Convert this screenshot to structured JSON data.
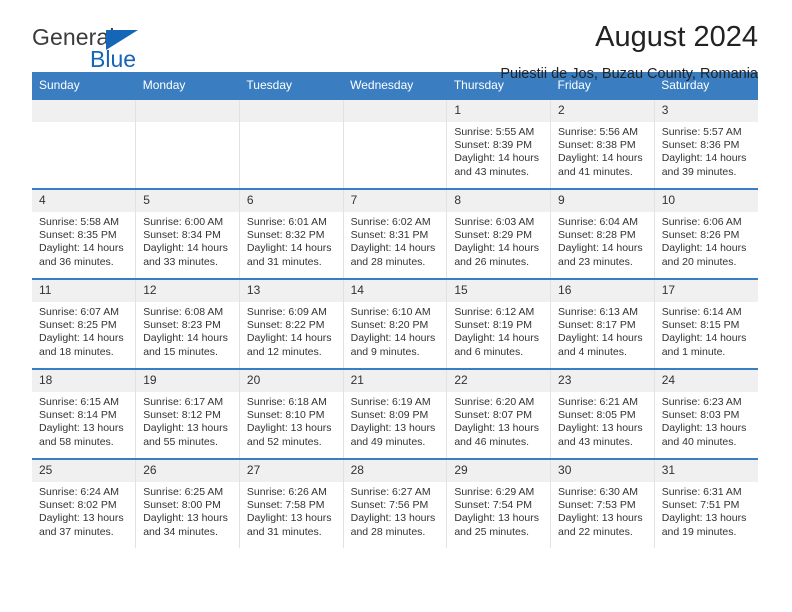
{
  "brand": {
    "name_top": "General",
    "name_bottom": "Blue",
    "accent_color": "#1565b8",
    "triangle_icon": "brand-triangle-icon"
  },
  "header": {
    "title": "August 2024",
    "subtitle": "Puiestii de Jos, Buzau County, Romania"
  },
  "theme": {
    "header_row_bg": "#3a7ec1",
    "day_band_bg": "#f0f0f0",
    "row_divider": "#3a7ec1",
    "text": "#333333"
  },
  "calendar": {
    "weekday_headers": [
      "Sunday",
      "Monday",
      "Tuesday",
      "Wednesday",
      "Thursday",
      "Friday",
      "Saturday"
    ],
    "weeks": [
      [
        {
          "day": "",
          "empty": true,
          "sunrise": "",
          "sunset": "",
          "daylight_line1": "",
          "daylight_line2": ""
        },
        {
          "day": "",
          "empty": true,
          "sunrise": "",
          "sunset": "",
          "daylight_line1": "",
          "daylight_line2": ""
        },
        {
          "day": "",
          "empty": true,
          "sunrise": "",
          "sunset": "",
          "daylight_line1": "",
          "daylight_line2": ""
        },
        {
          "day": "",
          "empty": true,
          "sunrise": "",
          "sunset": "",
          "daylight_line1": "",
          "daylight_line2": ""
        },
        {
          "day": "1",
          "sunrise": "Sunrise: 5:55 AM",
          "sunset": "Sunset: 8:39 PM",
          "daylight_line1": "Daylight: 14 hours",
          "daylight_line2": "and 43 minutes."
        },
        {
          "day": "2",
          "sunrise": "Sunrise: 5:56 AM",
          "sunset": "Sunset: 8:38 PM",
          "daylight_line1": "Daylight: 14 hours",
          "daylight_line2": "and 41 minutes."
        },
        {
          "day": "3",
          "sunrise": "Sunrise: 5:57 AM",
          "sunset": "Sunset: 8:36 PM",
          "daylight_line1": "Daylight: 14 hours",
          "daylight_line2": "and 39 minutes."
        }
      ],
      [
        {
          "day": "4",
          "sunrise": "Sunrise: 5:58 AM",
          "sunset": "Sunset: 8:35 PM",
          "daylight_line1": "Daylight: 14 hours",
          "daylight_line2": "and 36 minutes."
        },
        {
          "day": "5",
          "sunrise": "Sunrise: 6:00 AM",
          "sunset": "Sunset: 8:34 PM",
          "daylight_line1": "Daylight: 14 hours",
          "daylight_line2": "and 33 minutes."
        },
        {
          "day": "6",
          "sunrise": "Sunrise: 6:01 AM",
          "sunset": "Sunset: 8:32 PM",
          "daylight_line1": "Daylight: 14 hours",
          "daylight_line2": "and 31 minutes."
        },
        {
          "day": "7",
          "sunrise": "Sunrise: 6:02 AM",
          "sunset": "Sunset: 8:31 PM",
          "daylight_line1": "Daylight: 14 hours",
          "daylight_line2": "and 28 minutes."
        },
        {
          "day": "8",
          "sunrise": "Sunrise: 6:03 AM",
          "sunset": "Sunset: 8:29 PM",
          "daylight_line1": "Daylight: 14 hours",
          "daylight_line2": "and 26 minutes."
        },
        {
          "day": "9",
          "sunrise": "Sunrise: 6:04 AM",
          "sunset": "Sunset: 8:28 PM",
          "daylight_line1": "Daylight: 14 hours",
          "daylight_line2": "and 23 minutes."
        },
        {
          "day": "10",
          "sunrise": "Sunrise: 6:06 AM",
          "sunset": "Sunset: 8:26 PM",
          "daylight_line1": "Daylight: 14 hours",
          "daylight_line2": "and 20 minutes."
        }
      ],
      [
        {
          "day": "11",
          "sunrise": "Sunrise: 6:07 AM",
          "sunset": "Sunset: 8:25 PM",
          "daylight_line1": "Daylight: 14 hours",
          "daylight_line2": "and 18 minutes."
        },
        {
          "day": "12",
          "sunrise": "Sunrise: 6:08 AM",
          "sunset": "Sunset: 8:23 PM",
          "daylight_line1": "Daylight: 14 hours",
          "daylight_line2": "and 15 minutes."
        },
        {
          "day": "13",
          "sunrise": "Sunrise: 6:09 AM",
          "sunset": "Sunset: 8:22 PM",
          "daylight_line1": "Daylight: 14 hours",
          "daylight_line2": "and 12 minutes."
        },
        {
          "day": "14",
          "sunrise": "Sunrise: 6:10 AM",
          "sunset": "Sunset: 8:20 PM",
          "daylight_line1": "Daylight: 14 hours",
          "daylight_line2": "and 9 minutes."
        },
        {
          "day": "15",
          "sunrise": "Sunrise: 6:12 AM",
          "sunset": "Sunset: 8:19 PM",
          "daylight_line1": "Daylight: 14 hours",
          "daylight_line2": "and 6 minutes."
        },
        {
          "day": "16",
          "sunrise": "Sunrise: 6:13 AM",
          "sunset": "Sunset: 8:17 PM",
          "daylight_line1": "Daylight: 14 hours",
          "daylight_line2": "and 4 minutes."
        },
        {
          "day": "17",
          "sunrise": "Sunrise: 6:14 AM",
          "sunset": "Sunset: 8:15 PM",
          "daylight_line1": "Daylight: 14 hours",
          "daylight_line2": "and 1 minute."
        }
      ],
      [
        {
          "day": "18",
          "sunrise": "Sunrise: 6:15 AM",
          "sunset": "Sunset: 8:14 PM",
          "daylight_line1": "Daylight: 13 hours",
          "daylight_line2": "and 58 minutes."
        },
        {
          "day": "19",
          "sunrise": "Sunrise: 6:17 AM",
          "sunset": "Sunset: 8:12 PM",
          "daylight_line1": "Daylight: 13 hours",
          "daylight_line2": "and 55 minutes."
        },
        {
          "day": "20",
          "sunrise": "Sunrise: 6:18 AM",
          "sunset": "Sunset: 8:10 PM",
          "daylight_line1": "Daylight: 13 hours",
          "daylight_line2": "and 52 minutes."
        },
        {
          "day": "21",
          "sunrise": "Sunrise: 6:19 AM",
          "sunset": "Sunset: 8:09 PM",
          "daylight_line1": "Daylight: 13 hours",
          "daylight_line2": "and 49 minutes."
        },
        {
          "day": "22",
          "sunrise": "Sunrise: 6:20 AM",
          "sunset": "Sunset: 8:07 PM",
          "daylight_line1": "Daylight: 13 hours",
          "daylight_line2": "and 46 minutes."
        },
        {
          "day": "23",
          "sunrise": "Sunrise: 6:21 AM",
          "sunset": "Sunset: 8:05 PM",
          "daylight_line1": "Daylight: 13 hours",
          "daylight_line2": "and 43 minutes."
        },
        {
          "day": "24",
          "sunrise": "Sunrise: 6:23 AM",
          "sunset": "Sunset: 8:03 PM",
          "daylight_line1": "Daylight: 13 hours",
          "daylight_line2": "and 40 minutes."
        }
      ],
      [
        {
          "day": "25",
          "sunrise": "Sunrise: 6:24 AM",
          "sunset": "Sunset: 8:02 PM",
          "daylight_line1": "Daylight: 13 hours",
          "daylight_line2": "and 37 minutes."
        },
        {
          "day": "26",
          "sunrise": "Sunrise: 6:25 AM",
          "sunset": "Sunset: 8:00 PM",
          "daylight_line1": "Daylight: 13 hours",
          "daylight_line2": "and 34 minutes."
        },
        {
          "day": "27",
          "sunrise": "Sunrise: 6:26 AM",
          "sunset": "Sunset: 7:58 PM",
          "daylight_line1": "Daylight: 13 hours",
          "daylight_line2": "and 31 minutes."
        },
        {
          "day": "28",
          "sunrise": "Sunrise: 6:27 AM",
          "sunset": "Sunset: 7:56 PM",
          "daylight_line1": "Daylight: 13 hours",
          "daylight_line2": "and 28 minutes."
        },
        {
          "day": "29",
          "sunrise": "Sunrise: 6:29 AM",
          "sunset": "Sunset: 7:54 PM",
          "daylight_line1": "Daylight: 13 hours",
          "daylight_line2": "and 25 minutes."
        },
        {
          "day": "30",
          "sunrise": "Sunrise: 6:30 AM",
          "sunset": "Sunset: 7:53 PM",
          "daylight_line1": "Daylight: 13 hours",
          "daylight_line2": "and 22 minutes."
        },
        {
          "day": "31",
          "sunrise": "Sunrise: 6:31 AM",
          "sunset": "Sunset: 7:51 PM",
          "daylight_line1": "Daylight: 13 hours",
          "daylight_line2": "and 19 minutes."
        }
      ]
    ]
  }
}
